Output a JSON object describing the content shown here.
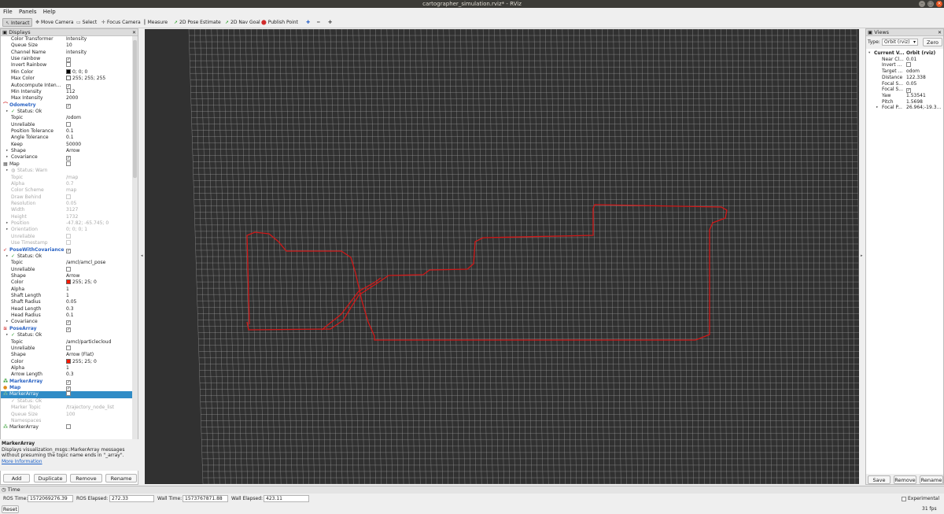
{
  "window": {
    "title": "cartographer_simulation.rviz* - RViz"
  },
  "menu": [
    "File",
    "Panels",
    "Help"
  ],
  "toolbar": {
    "tools": [
      {
        "label": "Interact",
        "icon": "interact-icon",
        "glyph": "↖",
        "active": true
      },
      {
        "label": "Move Camera",
        "icon": "move-camera-icon",
        "glyph": "✥"
      },
      {
        "label": "Select",
        "icon": "select-icon",
        "glyph": "▭"
      },
      {
        "label": "Focus Camera",
        "icon": "focus-camera-icon",
        "glyph": "✛"
      },
      {
        "label": "Measure",
        "icon": "measure-icon",
        "glyph": "┃"
      },
      {
        "label": "2D Pose Estimate",
        "icon": "pose-estimate-icon",
        "glyph": "➚",
        "color": "#2aa22a"
      },
      {
        "label": "2D Nav Goal",
        "icon": "nav-goal-icon",
        "glyph": "➚",
        "color": "#2aa22a"
      },
      {
        "label": "Publish Point",
        "icon": "publish-point-icon",
        "glyph": "⬤",
        "color": "#d02a2a"
      }
    ],
    "extra": [
      {
        "icon": "add-tool-icon",
        "glyph": "✚"
      },
      {
        "icon": "remove-tool-icon",
        "glyph": "━"
      },
      {
        "icon": "tool-properties-icon",
        "glyph": "✚"
      }
    ]
  },
  "displays": {
    "title": "Displays",
    "rows": [
      {
        "label": "Color Transformer",
        "value": "Intensity",
        "indent": 1
      },
      {
        "label": "Queue Size",
        "value": "10",
        "indent": 1
      },
      {
        "label": "Channel Name",
        "value": "intensity",
        "indent": 1
      },
      {
        "label": "Use rainbow",
        "check": true,
        "indent": 1
      },
      {
        "label": "Invert Rainbow",
        "check": false,
        "indent": 1
      },
      {
        "label": "Min Color",
        "value": "0; 0; 0",
        "swatch": "#000000",
        "indent": 1
      },
      {
        "label": "Max Color",
        "value": "255; 255; 255",
        "swatch": "#ffffff",
        "indent": 1
      },
      {
        "label": "Autocompute Inten...",
        "check": true,
        "indent": 1
      },
      {
        "label": "Min Intensity",
        "value": "112",
        "indent": 1
      },
      {
        "label": "Max Intensity",
        "value": "2000",
        "indent": 1
      },
      {
        "label": "Odometry",
        "check": true,
        "plugin": true,
        "icon": "odometry-icon",
        "glyph": "⌒",
        "iconColor": "#d02a2a",
        "indent": 0
      },
      {
        "label": "Status: Ok",
        "status": "ok",
        "arrow": true,
        "indent": 1
      },
      {
        "label": "Topic",
        "value": "/odom",
        "indent": 1
      },
      {
        "label": "Unreliable",
        "check": false,
        "indent": 1
      },
      {
        "label": "Position Tolerance",
        "value": "0.1",
        "indent": 1
      },
      {
        "label": "Angle Tolerance",
        "value": "0.1",
        "indent": 1
      },
      {
        "label": "Keep",
        "value": "50000",
        "indent": 1
      },
      {
        "label": "Shape",
        "value": "Arrow",
        "arrow": true,
        "indent": 1
      },
      {
        "label": "Covariance",
        "check": true,
        "arrow": true,
        "indent": 1
      },
      {
        "label": "Map",
        "check": false,
        "icon": "map-icon",
        "glyph": "▦",
        "iconColor": "#555",
        "indent": 0
      },
      {
        "label": "Status: Warn",
        "status": "warn",
        "arrow": true,
        "disabled": true,
        "indent": 1
      },
      {
        "label": "Topic",
        "value": "/map",
        "disabled": true,
        "indent": 1
      },
      {
        "label": "Alpha",
        "value": "0.7",
        "disabled": true,
        "indent": 1
      },
      {
        "label": "Color Scheme",
        "value": "map",
        "disabled": true,
        "indent": 1
      },
      {
        "label": "Draw Behind",
        "check": false,
        "disabled": true,
        "indent": 1
      },
      {
        "label": "Resolution",
        "value": "0.05",
        "disabled": true,
        "indent": 1
      },
      {
        "label": "Width",
        "value": "3127",
        "disabled": true,
        "indent": 1
      },
      {
        "label": "Height",
        "value": "1732",
        "disabled": true,
        "indent": 1
      },
      {
        "label": "Position",
        "value": "-47.82; -65.745; 0",
        "arrow": true,
        "disabled": true,
        "indent": 1
      },
      {
        "label": "Orientation",
        "value": "0; 0; 0; 1",
        "arrow": true,
        "disabled": true,
        "indent": 1
      },
      {
        "label": "Unreliable",
        "check": false,
        "disabled": true,
        "indent": 1
      },
      {
        "label": "Use Timestamp",
        "check": false,
        "disabled": true,
        "indent": 1
      },
      {
        "label": "PoseWithCovariance",
        "check": true,
        "plugin": true,
        "icon": "pose-with-covariance-icon",
        "glyph": "➶",
        "iconColor": "#d02a2a",
        "indent": 0
      },
      {
        "label": "Status: Ok",
        "status": "ok",
        "arrow": true,
        "indent": 1
      },
      {
        "label": "Topic",
        "value": "/amcl/amcl_pose",
        "indent": 1
      },
      {
        "label": "Unreliable",
        "check": false,
        "indent": 1
      },
      {
        "label": "Shape",
        "value": "Arrow",
        "indent": 1
      },
      {
        "label": "Color",
        "value": "255; 25; 0",
        "swatch": "#ff1900",
        "indent": 1
      },
      {
        "label": "Alpha",
        "value": "1",
        "indent": 1
      },
      {
        "label": "Shaft Length",
        "value": "1",
        "indent": 1
      },
      {
        "label": "Shaft Radius",
        "value": "0.05",
        "indent": 1
      },
      {
        "label": "Head Length",
        "value": "0.3",
        "indent": 1
      },
      {
        "label": "Head Radius",
        "value": "0.1",
        "indent": 1
      },
      {
        "label": "Covariance",
        "check": true,
        "arrow": true,
        "indent": 1
      },
      {
        "label": "PoseArray",
        "check": true,
        "plugin": true,
        "icon": "pose-array-icon",
        "glyph": "≋",
        "iconColor": "#d02a2a",
        "indent": 0
      },
      {
        "label": "Status: Ok",
        "status": "ok",
        "arrow": true,
        "indent": 1
      },
      {
        "label": "Topic",
        "value": "/amcl/particlecloud",
        "indent": 1
      },
      {
        "label": "Unreliable",
        "check": false,
        "indent": 1
      },
      {
        "label": "Shape",
        "value": "Arrow (Flat)",
        "indent": 1
      },
      {
        "label": "Color",
        "value": "255; 25; 0",
        "swatch": "#ff1900",
        "indent": 1
      },
      {
        "label": "Alpha",
        "value": "1",
        "indent": 1
      },
      {
        "label": "Arrow Length",
        "value": "0.3",
        "indent": 1
      },
      {
        "label": "MarkerArray",
        "check": true,
        "plugin": true,
        "icon": "marker-array-icon",
        "glyph": "⁂",
        "iconColor": "#2a9a2a",
        "indent": 0
      },
      {
        "label": "Map",
        "check": true,
        "plugin": true,
        "icon": "map-icon",
        "glyph": "●",
        "iconColor": "#e08a1a",
        "indent": 0
      },
      {
        "label": "MarkerArray",
        "check": false,
        "selected": true,
        "icon": "marker-array-icon",
        "glyph": "⁂",
        "iconColor": "#8fd08f",
        "indent": 0
      },
      {
        "label": "Status: Ok",
        "status": "ok",
        "disabled": true,
        "indent": 1
      },
      {
        "label": "Marker Topic",
        "value": "/trajectory_node_list",
        "disabled": true,
        "indent": 1
      },
      {
        "label": "Queue Size",
        "value": "100",
        "disabled": true,
        "indent": 1
      },
      {
        "label": "Namespaces",
        "disabled": true,
        "indent": 1
      },
      {
        "label": "MarkerArray",
        "check": false,
        "icon": "marker-array-icon",
        "glyph": "⁂",
        "iconColor": "#2a9a2a",
        "indent": 0
      }
    ]
  },
  "description": {
    "title": "MarkerArray",
    "text": "Displays visualization_msgs::MarkerArray messages without presuming the topic name ends in \"_array\".",
    "link": "More Information"
  },
  "display_buttons": [
    "Add",
    "Duplicate",
    "Remove",
    "Rename"
  ],
  "views": {
    "title": "Views",
    "type_label": "Type:",
    "type_value": "Orbit (rviz)",
    "zero": "Zero",
    "rows": [
      {
        "label": "Current V...",
        "value": "Orbit (rviz)",
        "bold": true,
        "arrow": "▾"
      },
      {
        "label": "Near Cl...",
        "value": "0.01"
      },
      {
        "label": "Invert ...",
        "check": false
      },
      {
        "label": "Target ...",
        "value": "odom"
      },
      {
        "label": "Distance",
        "value": "122.338"
      },
      {
        "label": "Focal S...",
        "value": "0.05"
      },
      {
        "label": "Focal S...",
        "check": true
      },
      {
        "label": "Yaw",
        "value": "1.53541"
      },
      {
        "label": "Pitch",
        "value": "1.5698"
      },
      {
        "label": "Focal P...",
        "value": "26.964;-19.3...",
        "arrow": "▸"
      }
    ],
    "buttons": [
      "Save",
      "Remove",
      "Rename"
    ]
  },
  "time": {
    "title": "Time",
    "ros_time_label": "ROS Time:",
    "ros_time": "1572069276.39",
    "ros_elapsed_label": "ROS Elapsed:",
    "ros_elapsed": "272.33",
    "wall_time_label": "Wall Time:",
    "wall_time": "1573767871.88",
    "wall_elapsed_label": "Wall Elapsed:",
    "wall_elapsed": "423.11",
    "experimental": "Experimental",
    "reset": "Reset",
    "fps": "31 fps"
  },
  "scene": {
    "background": "#313131",
    "grid_color": "#a0a0a0",
    "path_color": "#d01818"
  }
}
